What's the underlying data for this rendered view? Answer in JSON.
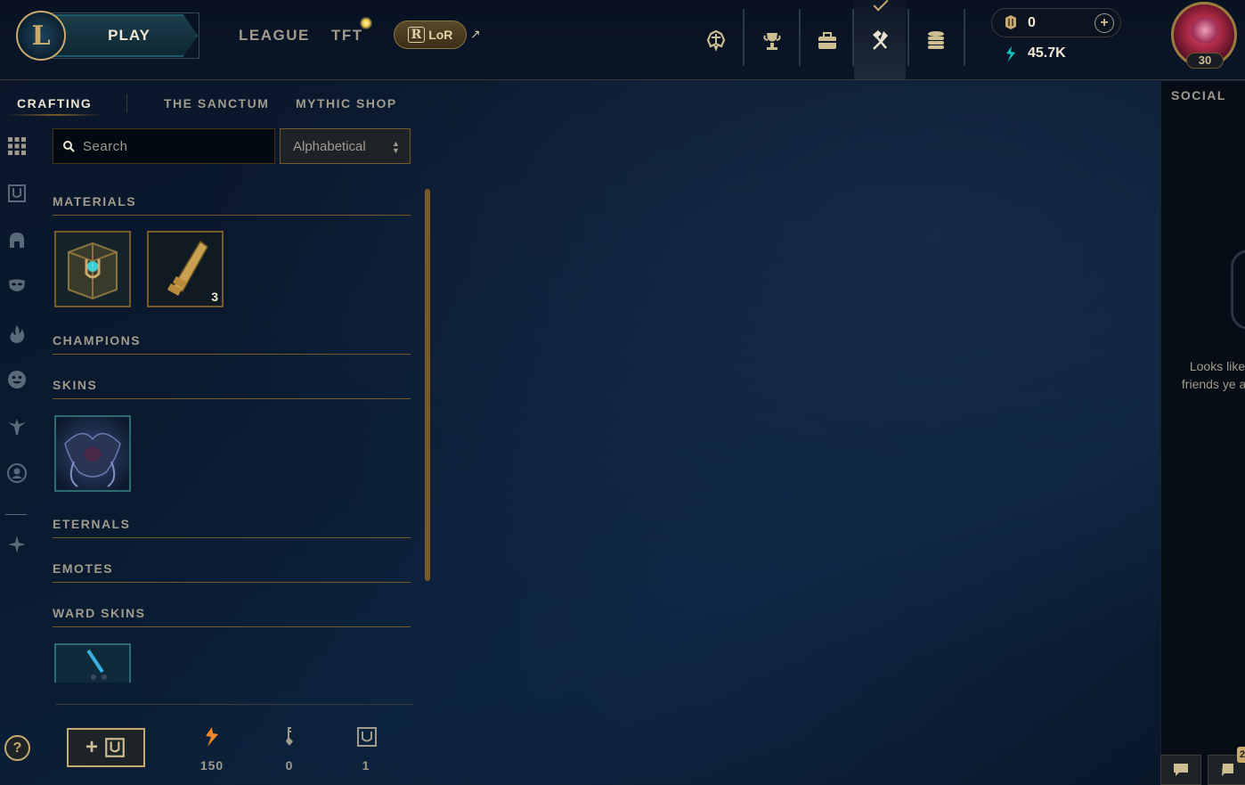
{
  "topbar": {
    "logo_letter": "L",
    "play_label": "PLAY",
    "nav": {
      "league": "LEAGUE",
      "tft": "TFT"
    },
    "lor_label": "LoR",
    "lor_glyph": "R",
    "external_arrow": "↗",
    "icons": [
      "clash-icon",
      "trophy-icon",
      "collection-icon",
      "crafting-icon",
      "store-icon"
    ],
    "active_icon": "crafting-icon"
  },
  "wallet": {
    "rp": "0",
    "blue_essence": "45.7K",
    "add_label": "+"
  },
  "profile": {
    "level": "30"
  },
  "crafting": {
    "tabs": [
      {
        "label": "CRAFTING",
        "active": true
      },
      {
        "label": "THE SANCTUM",
        "active": false
      },
      {
        "label": "MYTHIC SHOP",
        "active": false
      }
    ],
    "search_placeholder": "Search",
    "sort_value": "Alphabetical",
    "sections": {
      "materials": "MATERIALS",
      "champions": "CHAMPIONS",
      "skins": "SKINS",
      "eternals": "ETERNALS",
      "emotes": "EMOTES",
      "ward_skins": "WARD SKINS"
    },
    "material_items": [
      {
        "name": "chest",
        "count": ""
      },
      {
        "name": "key",
        "count": "3"
      }
    ],
    "footer": {
      "add_label": "+",
      "orange_essence": "150",
      "key_fragments": "0",
      "chests": "1"
    }
  },
  "social": {
    "title": "SOCIAL",
    "message": "Looks like friends ye an"
  },
  "side_categories": [
    "all-icon",
    "chest-icon",
    "champion-helmet-icon",
    "mask-skin-icon",
    "eternal-flame-icon",
    "emote-face-icon",
    "ward-icon",
    "profile-icon-icon",
    "tft-icon"
  ],
  "notification_count": "2",
  "help_label": "?",
  "colors": {
    "gold": "#c8aa6e",
    "gold_dark": "#785a28",
    "text_muted": "#a09b8c",
    "text_bright": "#f0e6d2",
    "teal": "#0ac8b9"
  }
}
